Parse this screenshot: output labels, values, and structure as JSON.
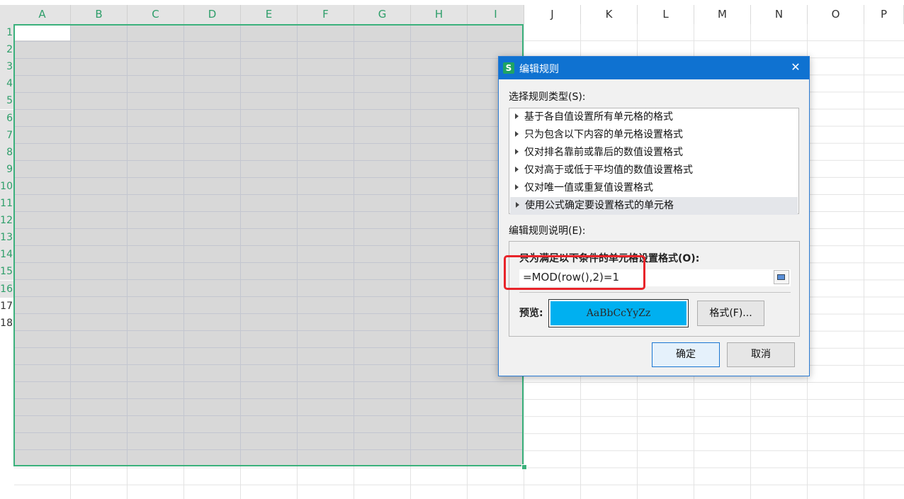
{
  "sheet": {
    "columns": [
      "A",
      "B",
      "C",
      "D",
      "E",
      "F",
      "G",
      "H",
      "I",
      "J",
      "K",
      "L",
      "M",
      "N",
      "O",
      "P"
    ],
    "rows": [
      "1",
      "2",
      "3",
      "4",
      "5",
      "6",
      "7",
      "8",
      "9",
      "10",
      "11",
      "12",
      "13",
      "14",
      "15",
      "16",
      "17",
      "18"
    ],
    "colors": {
      "selection_border": "#3bb17c",
      "selection_fill": "#d8d8d8"
    }
  },
  "dialog": {
    "title": "编辑规则",
    "app_icon": "S",
    "close_glyph": "✕",
    "rule_type_label": "选择规则类型(S):",
    "rule_types": [
      "基于各自值设置所有单元格的格式",
      "只为包含以下内容的单元格设置格式",
      "仅对排名靠前或靠后的数值设置格式",
      "仅对高于或低于平均值的数值设置格式",
      "仅对唯一值或重复值设置格式",
      "使用公式确定要设置格式的单元格"
    ],
    "selected_rule_index": 5,
    "edit_desc_label": "编辑规则说明(E):",
    "condition_label": "只为满足以下条件的单元格设置格式(O):",
    "formula": "=MOD(row(),2)=1",
    "preview_label": "预览:",
    "preview_text": "AaBbCcYyZz",
    "preview_color": "#00b0f0",
    "format_button": "格式(F)...",
    "ok_button": "确定",
    "cancel_button": "取消",
    "highlight_color": "#e8242a"
  }
}
